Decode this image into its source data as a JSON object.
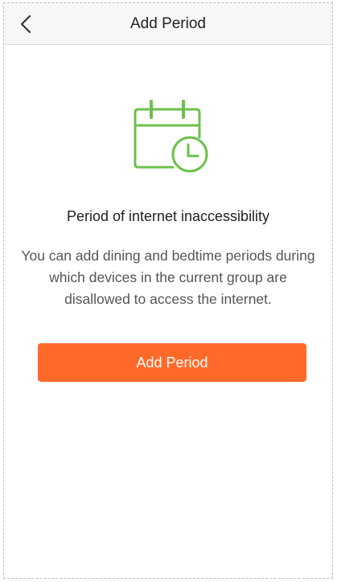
{
  "navbar": {
    "title": "Add Period",
    "back_icon": "chevron-left-icon"
  },
  "illustration": {
    "icon": "calendar-clock-icon",
    "color": "#6cc04a"
  },
  "content": {
    "heading": "Period of internet inaccessibility",
    "description": "You can add dining and bedtime periods during which devices in the current group are disallowed to access the internet."
  },
  "actions": {
    "add_period_label": "Add Period",
    "button_color": "#ff6a2a"
  }
}
